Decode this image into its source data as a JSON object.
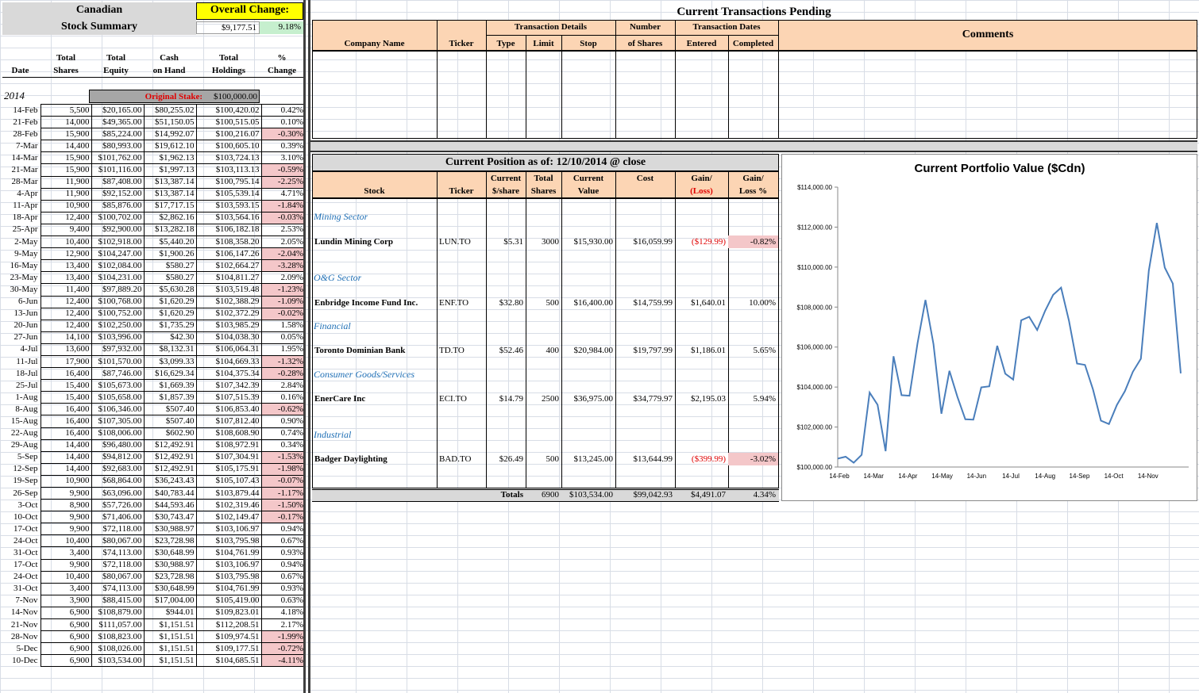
{
  "summary": {
    "title_line1": "Canadian",
    "title_line2": "Stock Summary",
    "overall_change_label": "Overall Change:",
    "overall_change_value": "$9,177.51",
    "overall_change_pct": "9.18%",
    "col_date": "Date",
    "col_total_shares": [
      "Total",
      "Shares"
    ],
    "col_total_equity": [
      "Total",
      "Equity"
    ],
    "col_cash": [
      "Cash",
      "on Hand"
    ],
    "col_holdings": [
      "Total",
      "Holdings"
    ],
    "col_change": [
      "%",
      "Change"
    ],
    "year": "2014",
    "original_stake_label": "Original Stake:",
    "original_stake_value": "$100,000.00",
    "rows": [
      [
        "14-Feb",
        "5,500",
        "$20,165.00",
        "$80,255.02",
        "$100,420.02",
        "0.42%",
        0
      ],
      [
        "21-Feb",
        "14,000",
        "$49,365.00",
        "$51,150.05",
        "$100,515.05",
        "0.10%",
        0
      ],
      [
        "28-Feb",
        "15,900",
        "$85,224.00",
        "$14,992.07",
        "$100,216.07",
        "-0.30%",
        1
      ],
      [
        "7-Mar",
        "14,400",
        "$80,993.00",
        "$19,612.10",
        "$100,605.10",
        "0.39%",
        0
      ],
      [
        "14-Mar",
        "15,900",
        "$101,762.00",
        "$1,962.13",
        "$103,724.13",
        "3.10%",
        0
      ],
      [
        "21-Mar",
        "15,900",
        "$101,116.00",
        "$1,997.13",
        "$103,113.13",
        "-0.59%",
        1
      ],
      [
        "28-Mar",
        "11,900",
        "$87,408.00",
        "$13,387.14",
        "$100,795.14",
        "-2.25%",
        1
      ],
      [
        "4-Apr",
        "11,900",
        "$92,152.00",
        "$13,387.14",
        "$105,539.14",
        "4.71%",
        0
      ],
      [
        "11-Apr",
        "10,900",
        "$85,876.00",
        "$17,717.15",
        "$103,593.15",
        "-1.84%",
        1
      ],
      [
        "18-Apr",
        "12,400",
        "$100,702.00",
        "$2,862.16",
        "$103,564.16",
        "-0.03%",
        1
      ],
      [
        "25-Apr",
        "9,400",
        "$92,900.00",
        "$13,282.18",
        "$106,182.18",
        "2.53%",
        0
      ],
      [
        "2-May",
        "10,400",
        "$102,918.00",
        "$5,440.20",
        "$108,358.20",
        "2.05%",
        0
      ],
      [
        "9-May",
        "12,900",
        "$104,247.00",
        "$1,900.26",
        "$106,147.26",
        "-2.04%",
        1
      ],
      [
        "16-May",
        "13,400",
        "$102,084.00",
        "$580.27",
        "$102,664.27",
        "-3.28%",
        1
      ],
      [
        "23-May",
        "13,400",
        "$104,231.00",
        "$580.27",
        "$104,811.27",
        "2.09%",
        0
      ],
      [
        "30-May",
        "11,400",
        "$97,889.20",
        "$5,630.28",
        "$103,519.48",
        "-1.23%",
        1
      ],
      [
        "6-Jun",
        "12,400",
        "$100,768.00",
        "$1,620.29",
        "$102,388.29",
        "-1.09%",
        1
      ],
      [
        "13-Jun",
        "12,400",
        "$100,752.00",
        "$1,620.29",
        "$102,372.29",
        "-0.02%",
        1
      ],
      [
        "20-Jun",
        "12,400",
        "$102,250.00",
        "$1,735.29",
        "$103,985.29",
        "1.58%",
        0
      ],
      [
        "27-Jun",
        "14,100",
        "$103,996.00",
        "$42.30",
        "$104,038.30",
        "0.05%",
        0
      ],
      [
        "4-Jul",
        "13,600",
        "$97,932.00",
        "$8,132.31",
        "$106,064.31",
        "1.95%",
        0
      ],
      [
        "11-Jul",
        "17,900",
        "$101,570.00",
        "$3,099.33",
        "$104,669.33",
        "-1.32%",
        1
      ],
      [
        "18-Jul",
        "16,400",
        "$87,746.00",
        "$16,629.34",
        "$104,375.34",
        "-0.28%",
        1
      ],
      [
        "25-Jul",
        "15,400",
        "$105,673.00",
        "$1,669.39",
        "$107,342.39",
        "2.84%",
        0
      ],
      [
        "1-Aug",
        "15,400",
        "$105,658.00",
        "$1,857.39",
        "$107,515.39",
        "0.16%",
        0
      ],
      [
        "8-Aug",
        "16,400",
        "$106,346.00",
        "$507.40",
        "$106,853.40",
        "-0.62%",
        1
      ],
      [
        "15-Aug",
        "16,400",
        "$107,305.00",
        "$507.40",
        "$107,812.40",
        "0.90%",
        0
      ],
      [
        "22-Aug",
        "16,400",
        "$108,006.00",
        "$602.90",
        "$108,608.90",
        "0.74%",
        0
      ],
      [
        "29-Aug",
        "14,400",
        "$96,480.00",
        "$12,492.91",
        "$108,972.91",
        "0.34%",
        0
      ],
      [
        "5-Sep",
        "14,400",
        "$94,812.00",
        "$12,492.91",
        "$107,304.91",
        "-1.53%",
        1
      ],
      [
        "12-Sep",
        "14,400",
        "$92,683.00",
        "$12,492.91",
        "$105,175.91",
        "-1.98%",
        1
      ],
      [
        "19-Sep",
        "10,900",
        "$68,864.00",
        "$36,243.43",
        "$105,107.43",
        "-0.07%",
        1
      ],
      [
        "26-Sep",
        "9,900",
        "$63,096.00",
        "$40,783.44",
        "$103,879.44",
        "-1.17%",
        1
      ],
      [
        "3-Oct",
        "8,900",
        "$57,726.00",
        "$44,593.46",
        "$102,319.46",
        "-1.50%",
        1
      ],
      [
        "10-Oct",
        "9,900",
        "$71,406.00",
        "$30,743.47",
        "$102,149.47",
        "-0.17%",
        1
      ],
      [
        "17-Oct",
        "9,900",
        "$72,118.00",
        "$30,988.97",
        "$103,106.97",
        "0.94%",
        0
      ],
      [
        "24-Oct",
        "10,400",
        "$80,067.00",
        "$23,728.98",
        "$103,795.98",
        "0.67%",
        0
      ],
      [
        "31-Oct",
        "3,400",
        "$74,113.00",
        "$30,648.99",
        "$104,761.99",
        "0.93%",
        0
      ],
      [
        "17-Oct",
        "9,900",
        "$72,118.00",
        "$30,988.97",
        "$103,106.97",
        "0.94%",
        0
      ],
      [
        "24-Oct",
        "10,400",
        "$80,067.00",
        "$23,728.98",
        "$103,795.98",
        "0.67%",
        0
      ],
      [
        "31-Oct",
        "3,400",
        "$74,113.00",
        "$30,648.99",
        "$104,761.99",
        "0.93%",
        0
      ],
      [
        "7-Nov",
        "3,900",
        "$88,415.00",
        "$17,004.00",
        "$105,419.00",
        "0.63%",
        0
      ],
      [
        "14-Nov",
        "6,900",
        "$108,879.00",
        "$944.01",
        "$109,823.01",
        "4.18%",
        0
      ],
      [
        "21-Nov",
        "6,900",
        "$111,057.00",
        "$1,151.51",
        "$112,208.51",
        "2.17%",
        0
      ],
      [
        "28-Nov",
        "6,900",
        "$108,823.00",
        "$1,151.51",
        "$109,974.51",
        "-1.99%",
        1
      ],
      [
        "5-Dec",
        "6,900",
        "$108,026.00",
        "$1,151.51",
        "$109,177.51",
        "-0.72%",
        1
      ],
      [
        "10-Dec",
        "6,900",
        "$103,534.00",
        "$1,151.51",
        "$104,685.51",
        "-4.11%",
        1
      ]
    ]
  },
  "pending": {
    "title": "Current Transactions Pending",
    "company_name": "Company Name",
    "ticker": "Ticker",
    "tx_details": "Transaction Details",
    "type": "Type",
    "limit": "Limit",
    "stop": "Stop",
    "number": "Number",
    "of_shares": "of Shares",
    "tx_dates": "Transaction Dates",
    "entered": "Entered",
    "completed": "Completed",
    "comments": "Comments"
  },
  "position": {
    "title": "Current Position as of:  12/10/2014  @ close",
    "h_stock": "Stock",
    "h_ticker": "Ticker",
    "h_current1": "Current",
    "h_current2": "$/share",
    "h_total1": "Total",
    "h_total2": "Shares",
    "h_value1": "Current",
    "h_value2": "Value",
    "h_cost": "Cost",
    "h_gain1": "Gain/",
    "h_gain2": "(Loss)",
    "h_gainpct1": "Gain/",
    "h_gainpct2": "Loss %",
    "sectors": [
      "Mining Sector",
      "O&G Sector",
      "Financial",
      "Consumer Goods/Services",
      "Industrial"
    ],
    "stocks": [
      {
        "name": "Lundin Mining Corp",
        "ticker": "LUN.TO",
        "price": "$5.31",
        "shares": "3000",
        "value": "$15,930.00",
        "cost": "$16,059.99",
        "gain": "($129.99)",
        "pct": "-0.82%"
      },
      {
        "name": "Enbridge Income Fund Inc.",
        "ticker": "ENF.TO",
        "price": "$32.80",
        "shares": "500",
        "value": "$16,400.00",
        "cost": "$14,759.99",
        "gain": "$1,640.01",
        "pct": "10.00%"
      },
      {
        "name": "Toronto Dominian Bank",
        "ticker": "TD.TO",
        "price": "$52.46",
        "shares": "400",
        "value": "$20,984.00",
        "cost": "$19,797.99",
        "gain": "$1,186.01",
        "pct": "5.65%"
      },
      {
        "name": "EnerCare Inc",
        "ticker": "ECI.TO",
        "price": "$14.79",
        "shares": "2500",
        "value": "$36,975.00",
        "cost": "$34,779.97",
        "gain": "$2,195.03",
        "pct": "5.94%"
      },
      {
        "name": "Badger Daylighting",
        "ticker": "BAD.TO",
        "price": "$26.49",
        "shares": "500",
        "value": "$13,245.00",
        "cost": "$13,644.99",
        "gain": "($399.99)",
        "pct": "-3.02%"
      }
    ],
    "totals_label": "Totals",
    "totals_shares": "6900",
    "totals_value": "$103,534.00",
    "totals_cost": "$99,042.93",
    "totals_gain": "$4,491.07",
    "totals_pct": "4.34%"
  },
  "chart_data": {
    "type": "line",
    "title": "Current Portfolio Value ($Cdn)",
    "ylim": [
      100000,
      114000
    ],
    "yticks": [
      "$100,000.00",
      "$102,000.00",
      "$104,000.00",
      "$106,000.00",
      "$108,000.00",
      "$110,000.00",
      "$112,000.00",
      "$114,000.00"
    ],
    "xticks": [
      "14-Feb",
      "14-Mar",
      "14-Apr",
      "14-May",
      "14-Jun",
      "14-Jul",
      "14-Aug",
      "14-Sep",
      "14-Oct",
      "14-Nov"
    ],
    "series": [
      {
        "values": [
          100420.02,
          100515.05,
          100216.07,
          100605.1,
          103724.13,
          103113.13,
          100795.14,
          105539.14,
          103593.15,
          103564.16,
          106182.18,
          108358.2,
          106147.26,
          102664.27,
          104811.27,
          103519.48,
          102388.29,
          102372.29,
          103985.29,
          104038.3,
          106064.31,
          104669.33,
          104375.34,
          107342.39,
          107515.39,
          106853.4,
          107812.4,
          108608.9,
          108972.91,
          107304.91,
          105175.91,
          105107.43,
          103879.44,
          102319.46,
          102149.47,
          103106.97,
          103795.98,
          104761.99,
          105419.0,
          109823.01,
          112208.51,
          109974.51,
          109177.51,
          104685.51
        ]
      }
    ],
    "line_color": "#4a7ebb"
  }
}
